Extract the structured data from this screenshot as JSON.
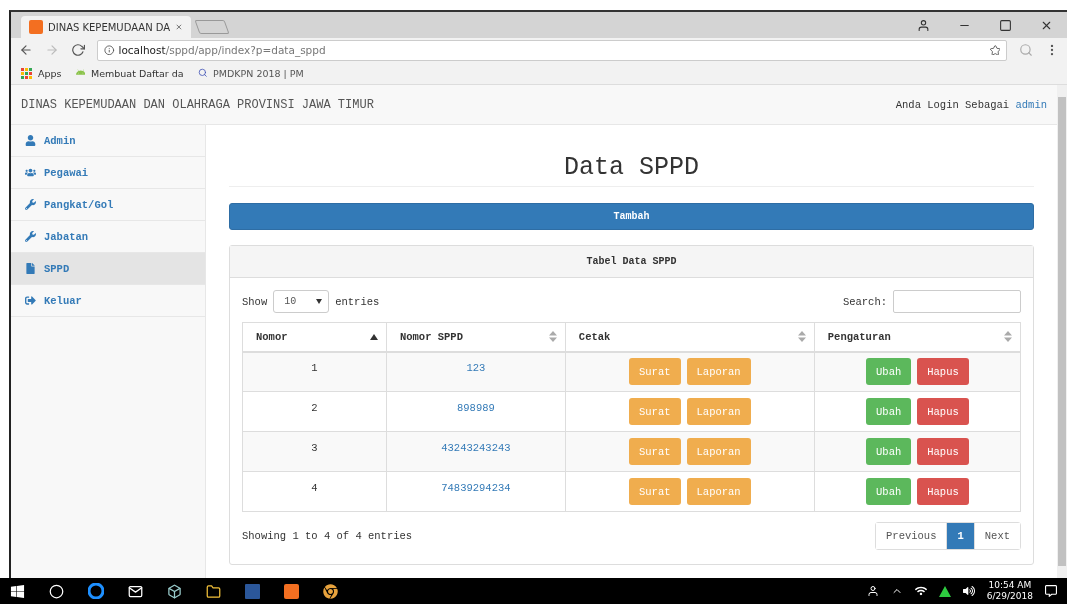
{
  "browser": {
    "tab_title": "DINAS KEPEMUDAAN DA",
    "url_host": "localhost",
    "url_path": "/sppd/app/index?p=data_sppd",
    "bookmarks": [
      {
        "kind": "apps",
        "label": "Apps"
      },
      {
        "kind": "android",
        "label": "Membuat Daftar da"
      },
      {
        "kind": "search",
        "label": "PMDKPN 2018 | PM"
      }
    ]
  },
  "header": {
    "title": "DINAS KEPEMUDAAN DAN OLAHRAGA PROVINSI JAWA TIMUR",
    "login_text": "Anda Login Sebagai",
    "user": "admin"
  },
  "sidebar": {
    "items": [
      {
        "label": "Admin",
        "selected": false
      },
      {
        "label": "Pegawai",
        "selected": false
      },
      {
        "label": "Pangkat/Gol",
        "selected": false
      },
      {
        "label": "Jabatan",
        "selected": false
      },
      {
        "label": "SPPD",
        "selected": true
      },
      {
        "label": "Keluar",
        "selected": false
      }
    ]
  },
  "page_title": "Data SPPD",
  "add_button": "Tambah",
  "panel": {
    "title": "Tabel Data SPPD",
    "show_label": "Show",
    "length": "10",
    "entries_label": "entries",
    "search_label": "Search:",
    "columns": [
      {
        "label": "Nomor",
        "sorted": true
      },
      {
        "label": "Nomor SPPD",
        "sorted": false
      },
      {
        "label": "Cetak",
        "sorted": false
      },
      {
        "label": "Pengaturan",
        "sorted": false
      }
    ],
    "rows": [
      {
        "nomor": "1",
        "nomor_sppd": "123",
        "print_buttons": [
          "Surat",
          "Laporan"
        ],
        "edit": "Ubah",
        "delete": "Hapus"
      },
      {
        "nomor": "2",
        "nomor_sppd": "898989",
        "print_buttons": [
          "Surat",
          "Laporan"
        ],
        "edit": "Ubah",
        "delete": "Hapus"
      },
      {
        "nomor": "3",
        "nomor_sppd": "43243243243",
        "print_buttons": [
          "Surat",
          "Laporan"
        ],
        "edit": "Ubah",
        "delete": "Hapus"
      },
      {
        "nomor": "4",
        "nomor_sppd": "74839294234",
        "print_buttons": [
          "Surat",
          "Laporan"
        ],
        "edit": "Ubah",
        "delete": "Hapus"
      }
    ],
    "info": "Showing 1 to 4 of 4 entries",
    "pagination": [
      {
        "label": "Previous",
        "selected": false
      },
      {
        "label": "1",
        "selected": true
      },
      {
        "label": "Next",
        "selected": false
      }
    ]
  },
  "taskbar": {
    "time": "10:54 AM",
    "date": "6/29/2018"
  }
}
